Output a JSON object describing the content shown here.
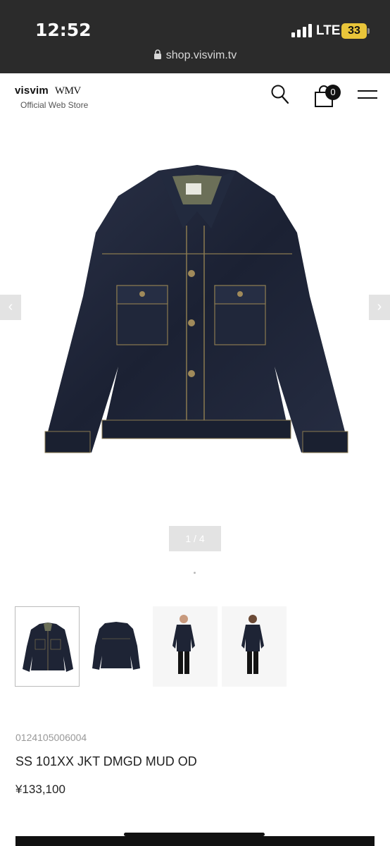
{
  "status": {
    "time": "12:52",
    "network": "LTE",
    "battery": "33"
  },
  "browser": {
    "url": "shop.visvim.tv"
  },
  "header": {
    "brand": "visvim",
    "brand2": "WMV",
    "subtitle": "Official Web Store",
    "cart_count": "0"
  },
  "gallery": {
    "pager": "1 / 4",
    "prev": "‹",
    "next": "›"
  },
  "product": {
    "code": "0124105006004",
    "name": "SS 101XX JKT DMGD MUD OD",
    "price": "¥133,100"
  },
  "colors": {
    "status_bg": "#2b2b2b",
    "denim": "#1e2435",
    "battery": "#e9c53a"
  }
}
